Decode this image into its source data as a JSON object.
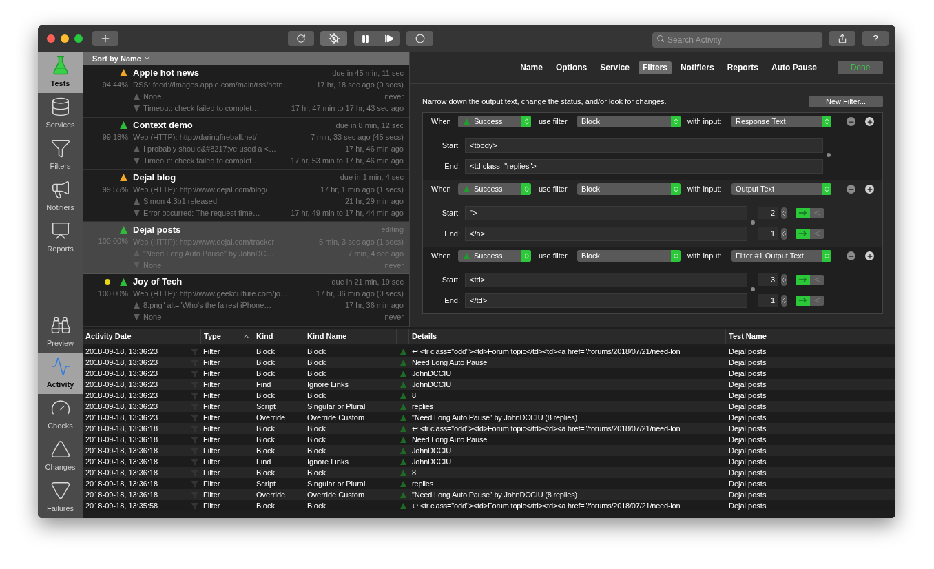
{
  "toolbar": {
    "search": {
      "placeholder": "Search Activity"
    },
    "help": "?"
  },
  "sidebar": {
    "top": [
      {
        "label": "Tests",
        "selected": true
      },
      {
        "label": "Services",
        "selected": false
      },
      {
        "label": "Filters",
        "selected": false
      },
      {
        "label": "Notifiers",
        "selected": false
      },
      {
        "label": "Reports",
        "selected": false
      }
    ],
    "bottom": [
      {
        "label": "Preview",
        "selected": false
      },
      {
        "label": "Activity",
        "selected": true
      },
      {
        "label": "Checks",
        "selected": false
      },
      {
        "label": "Changes",
        "selected": false
      },
      {
        "label": "Failures",
        "selected": false
      }
    ]
  },
  "test_list": {
    "sort": "Sort by Name",
    "tests": [
      {
        "name": "Apple hot news",
        "warning": true,
        "selected": false,
        "percent": "94.44%",
        "due": "due in 45 min, 11 sec",
        "service": "RSS: feed://images.apple.com/main/rss/hotn…",
        "checked": "17 hr, 18 sec ago (0 secs)",
        "up_text": "None",
        "up_time": "never",
        "down_text": "Timeout: check failed to complet…",
        "down_time": "17 hr, 47 min to 17 hr, 43 sec ago"
      },
      {
        "name": "Context demo",
        "warning": false,
        "selected": false,
        "percent": "99.18%",
        "due": "due in 8 min, 12 sec",
        "service": "Web (HTTP): http://daringfireball.net/",
        "checked": "7 min, 33 sec ago (45 secs)",
        "up_text": "I probably should&#8217;ve used a <…",
        "up_time": "17 hr, 46 min ago",
        "down_text": "Timeout: check failed to complet…",
        "down_time": "17 hr, 53 min to 17 hr, 46 min ago"
      },
      {
        "name": "Dejal blog",
        "warning": true,
        "selected": false,
        "percent": "99.55%",
        "due": "due in 1 min, 4 sec",
        "service": "Web (HTTP): http://www.dejal.com/blog/",
        "checked": "17 hr, 1 min ago (1 secs)",
        "up_text": "Simon 4.3b1 released",
        "up_time": "21 hr, 29 min ago",
        "down_text": "Error occurred: The request time…",
        "down_time": "17 hr, 49 min to 17 hr, 44 min ago"
      },
      {
        "name": "Dejal posts",
        "warning": false,
        "selected": true,
        "percent": "100.00%",
        "due": "editing",
        "service": "Web (HTTP): http://www.dejal.com/tracker",
        "checked": "5 min, 3 sec ago (1 secs)",
        "up_text": "\"Need Long Auto Pause\" by JohnDC…",
        "up_time": "7 min, 4 sec ago",
        "down_text": "None",
        "down_time": "never"
      },
      {
        "name": "Joy of Tech",
        "warning": false,
        "selected": false,
        "color": "#e8d81a",
        "percent": "100.00%",
        "due": "due in 21 min, 19 sec",
        "service": "Web (HTTP): http://www.geekculture.com/jo…",
        "checked": "17 hr, 36 min ago (0 secs)",
        "up_text": "8.png\" alt=\"Who's the fairest iPhone…",
        "up_time": "17 hr, 36 min ago",
        "down_text": "None",
        "down_time": "never"
      }
    ]
  },
  "editor": {
    "tabs": [
      {
        "label": "Name",
        "selected": false
      },
      {
        "label": "Options",
        "selected": false
      },
      {
        "label": "Service",
        "selected": false
      },
      {
        "label": "Filters",
        "selected": true
      },
      {
        "label": "Notifiers",
        "selected": false
      },
      {
        "label": "Reports",
        "selected": false
      },
      {
        "label": "Auto Pause",
        "selected": false
      }
    ],
    "done": "Done",
    "description": "Narrow down the output text, change the status, and/or look for changes.",
    "new_filter": "New Filter...",
    "filters": [
      {
        "when": "When",
        "status": "Success",
        "use_filter": "use filter",
        "filter": "Block",
        "with_input": "with input:",
        "input": "Response Text",
        "start_label": "Start:",
        "start": "<tbody>",
        "end_label": "End:",
        "end": "<td class=\"replies\">"
      },
      {
        "when": "When",
        "status": "Success",
        "use_filter": "use filter",
        "filter": "Block",
        "with_input": "with input:",
        "input": "Output Text",
        "start_label": "Start:",
        "start": "\">",
        "start_count": "2",
        "start_forward": true,
        "end_label": "End:",
        "end": "</a>",
        "end_count": "1",
        "end_forward": true
      },
      {
        "when": "When",
        "status": "Success",
        "use_filter": "use filter",
        "filter": "Block",
        "with_input": "with input:",
        "input": "Filter #1 Output Text",
        "start_label": "Start:",
        "start": "<td>",
        "start_count": "3",
        "start_forward": true,
        "end_label": "End:",
        "end": "</td>",
        "end_count": "1",
        "end_forward": true
      }
    ]
  },
  "activity": {
    "columns": [
      {
        "label": "Activity Date",
        "sorted": false
      },
      {
        "label": "Type",
        "sorted": true
      },
      {
        "label": "Kind",
        "sorted": false
      },
      {
        "label": "Kind Name",
        "sorted": false
      },
      {
        "label": "Details",
        "sorted": false
      },
      {
        "label": "Test Name",
        "sorted": false
      }
    ],
    "rows": [
      {
        "date": "2018-09-18, 13:36:23",
        "type": "Filter",
        "kind": "Block",
        "kind_name": "Block",
        "details": "↩ <tr class=\"odd\"><td>Forum topic</td><td><a href=\"/forums/2018/07/21/need-lon",
        "test_name": "Dejal posts"
      },
      {
        "date": "2018-09-18, 13:36:23",
        "type": "Filter",
        "kind": "Block",
        "kind_name": "Block",
        "details": "Need Long Auto Pause",
        "test_name": "Dejal posts"
      },
      {
        "date": "2018-09-18, 13:36:23",
        "type": "Filter",
        "kind": "Block",
        "kind_name": "Block",
        "details": "JohnDCCIU",
        "test_name": "Dejal posts"
      },
      {
        "date": "2018-09-18, 13:36:23",
        "type": "Filter",
        "kind": "Find",
        "kind_name": "Ignore Links",
        "details": "JohnDCCIU",
        "test_name": "Dejal posts"
      },
      {
        "date": "2018-09-18, 13:36:23",
        "type": "Filter",
        "kind": "Block",
        "kind_name": "Block",
        "details": "8",
        "test_name": "Dejal posts"
      },
      {
        "date": "2018-09-18, 13:36:23",
        "type": "Filter",
        "kind": "Script",
        "kind_name": "Singular or Plural",
        "details": "replies",
        "test_name": "Dejal posts"
      },
      {
        "date": "2018-09-18, 13:36:23",
        "type": "Filter",
        "kind": "Override",
        "kind_name": "Override Custom",
        "details": "\"Need Long Auto Pause\" by JohnDCCIU (8 replies)",
        "test_name": "Dejal posts"
      },
      {
        "date": "2018-09-18, 13:36:18",
        "type": "Filter",
        "kind": "Block",
        "kind_name": "Block",
        "details": "↩ <tr class=\"odd\"><td>Forum topic</td><td><a href=\"/forums/2018/07/21/need-lon",
        "test_name": "Dejal posts"
      },
      {
        "date": "2018-09-18, 13:36:18",
        "type": "Filter",
        "kind": "Block",
        "kind_name": "Block",
        "details": "Need Long Auto Pause",
        "test_name": "Dejal posts"
      },
      {
        "date": "2018-09-18, 13:36:18",
        "type": "Filter",
        "kind": "Block",
        "kind_name": "Block",
        "details": "JohnDCCIU",
        "test_name": "Dejal posts"
      },
      {
        "date": "2018-09-18, 13:36:18",
        "type": "Filter",
        "kind": "Find",
        "kind_name": "Ignore Links",
        "details": "JohnDCCIU",
        "test_name": "Dejal posts"
      },
      {
        "date": "2018-09-18, 13:36:18",
        "type": "Filter",
        "kind": "Block",
        "kind_name": "Block",
        "details": "8",
        "test_name": "Dejal posts"
      },
      {
        "date": "2018-09-18, 13:36:18",
        "type": "Filter",
        "kind": "Script",
        "kind_name": "Singular or Plural",
        "details": "replies",
        "test_name": "Dejal posts"
      },
      {
        "date": "2018-09-18, 13:36:18",
        "type": "Filter",
        "kind": "Override",
        "kind_name": "Override Custom",
        "details": "\"Need Long Auto Pause\" by JohnDCCIU (8 replies)",
        "test_name": "Dejal posts"
      },
      {
        "date": "2018-09-18, 13:35:58",
        "type": "Filter",
        "kind": "Block",
        "kind_name": "Block",
        "details": "↩ <tr class=\"odd\"><td>Forum topic</td><td><a href=\"/forums/2018/07/21/need-lon",
        "test_name": "Dejal posts"
      }
    ]
  }
}
